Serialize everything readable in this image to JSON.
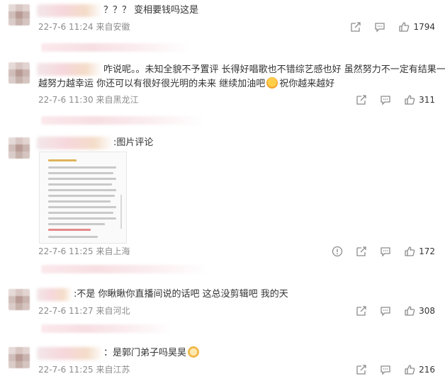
{
  "comments": [
    {
      "text": "？？？ 变相要钱吗这是",
      "time": "22-7-6 11:24",
      "location": "来自安徽",
      "likes": "1794",
      "actions": [
        "share-icon",
        "comment-icon",
        "like-icon"
      ]
    },
    {
      "text_line1": "咋说呢。。未知全貌不予置评 长得好唱歌也不错综艺感也好 虽然努力不一定有结果一定",
      "text_line2a": "越努力越幸运 你还可以有很好很光明的未来 继续加油吧",
      "text_line2b": "祝你越来越好",
      "time": "22-7-6 11:30",
      "location": "来自黑龙江",
      "likes": "311",
      "actions": [
        "share-icon",
        "comment-icon",
        "like-icon"
      ]
    },
    {
      "text": ":图片评论",
      "time": "22-7-6 11:25",
      "location": "来自上海",
      "likes": "172",
      "actions": [
        "report-icon",
        "share-icon",
        "comment-icon",
        "like-icon"
      ]
    },
    {
      "text": ":不是 你瞅瞅你直播间说的话吧 这总没剪辑吧 我的天",
      "time": "22-7-6 11:27",
      "location": "来自河北",
      "likes": "308",
      "actions": [
        "share-icon",
        "comment-icon",
        "like-icon"
      ]
    },
    {
      "text": "：是郭门弟子吗昊昊",
      "time": "22-7-6 11:25",
      "location": "来自江苏",
      "likes": "216",
      "actions": [
        "share-icon",
        "comment-icon",
        "like-icon"
      ]
    }
  ],
  "colors": {
    "text": "#333333",
    "meta": "#8c8c8c",
    "icon": "#8c8c8c"
  }
}
